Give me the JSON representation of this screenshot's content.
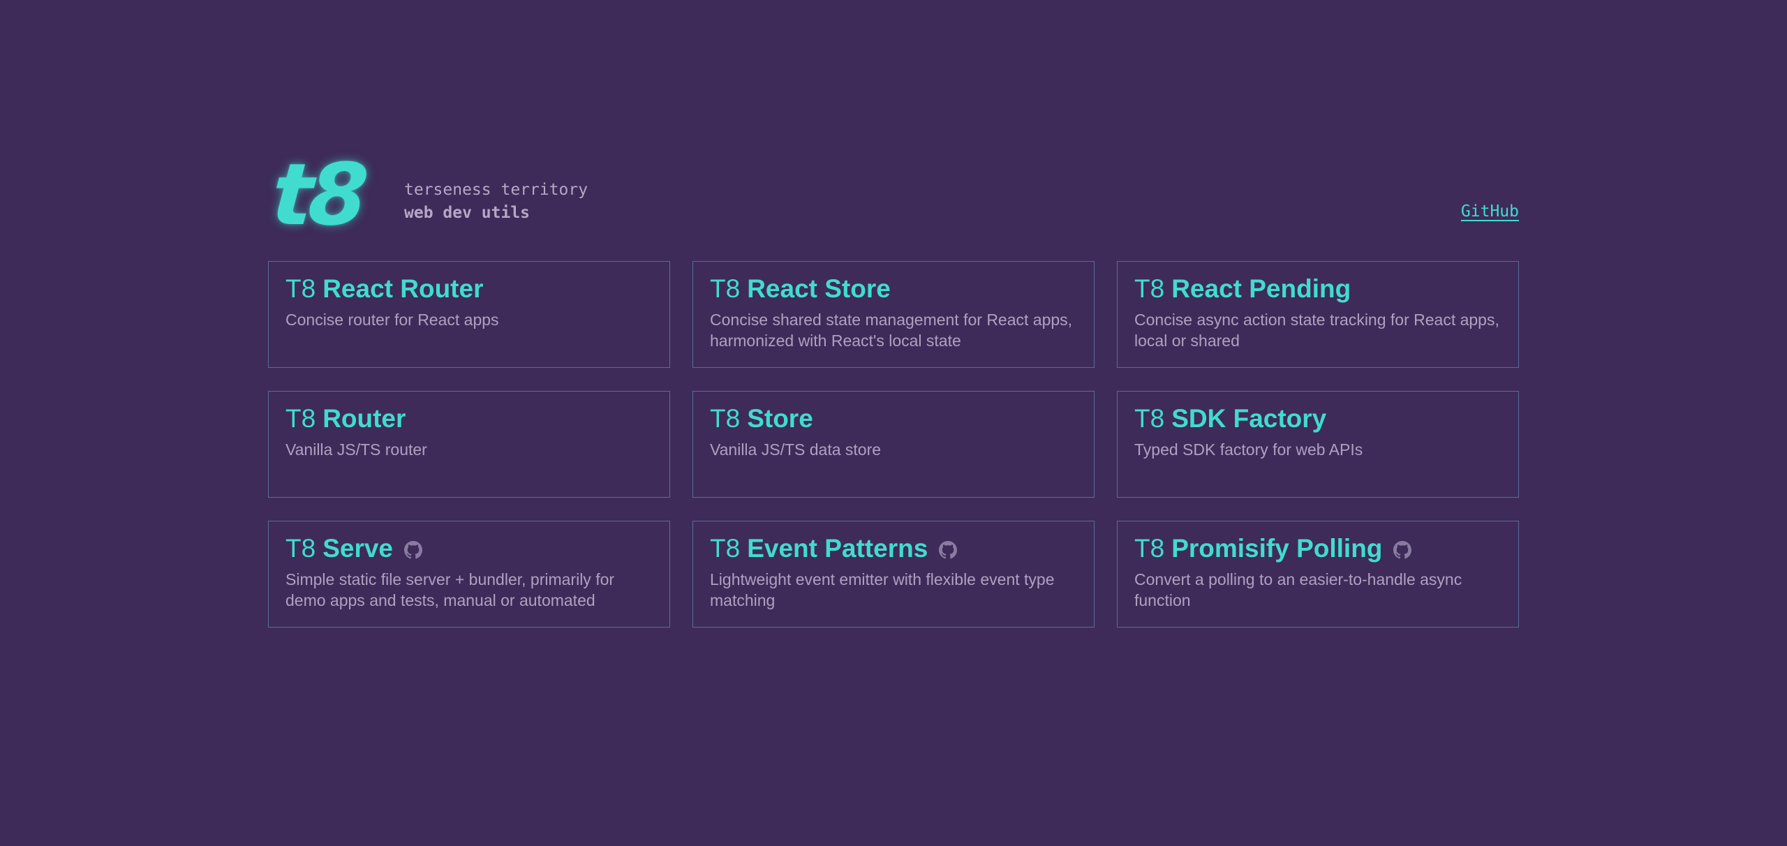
{
  "header": {
    "logo": "t8",
    "tagline_1": "terseness territory",
    "tagline_2": "web dev utils",
    "github_link": "GitHub"
  },
  "cards": [
    {
      "prefix": "T8",
      "name": "React Router",
      "description": "Concise router for React apps",
      "github_icon": false
    },
    {
      "prefix": "T8",
      "name": "React Store",
      "description": "Concise shared state management for React apps, harmonized with React's local state",
      "github_icon": false
    },
    {
      "prefix": "T8",
      "name": "React Pending",
      "description": "Concise async action state tracking for React apps, local or shared",
      "github_icon": false
    },
    {
      "prefix": "T8",
      "name": "Router",
      "description": "Vanilla JS/TS router",
      "github_icon": false
    },
    {
      "prefix": "T8",
      "name": "Store",
      "description": "Vanilla JS/TS data store",
      "github_icon": false
    },
    {
      "prefix": "T8",
      "name": "SDK Factory",
      "description": "Typed SDK factory for web APIs",
      "github_icon": false
    },
    {
      "prefix": "T8",
      "name": "Serve",
      "description": "Simple static file server + bundler, primarily for demo apps and tests, manual or automated",
      "github_icon": true
    },
    {
      "prefix": "T8",
      "name": "Event Patterns",
      "description": "Lightweight event emitter with flexible event type matching",
      "github_icon": true
    },
    {
      "prefix": "T8",
      "name": "Promisify Polling",
      "description": "Convert a polling to an easier-to-handle async function",
      "github_icon": true
    }
  ],
  "colors": {
    "background": "#3e2b5a",
    "accent": "#40dcd0",
    "card_border": "#5a6c99",
    "muted_text": "#b0a0c0",
    "icon": "#8a7ca0"
  },
  "icons": {
    "repo_icon": "github-icon"
  }
}
